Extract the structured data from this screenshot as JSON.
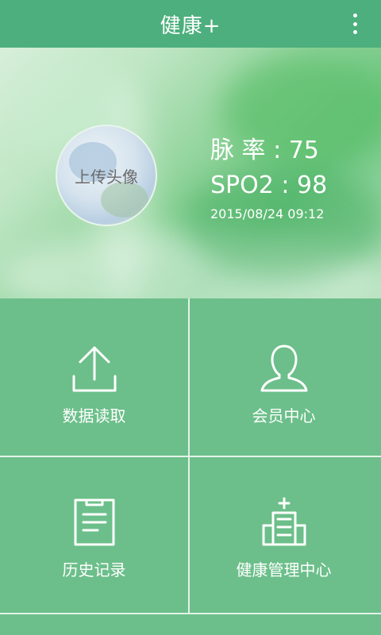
{
  "header": {
    "title": "健康+",
    "menu_icon": "more-vertical-icon"
  },
  "profile": {
    "avatar_label": "上传头像",
    "pulse_text": "脉 率 : 75",
    "spo2_text": "SPO2 : 98",
    "timestamp": "2015/08/24  09:12"
  },
  "tiles": [
    {
      "label": "数据读取",
      "icon": "upload-icon"
    },
    {
      "label": "会员中心",
      "icon": "user-icon"
    },
    {
      "label": "历史记录",
      "icon": "clipboard-icon"
    },
    {
      "label": "健康管理中心",
      "icon": "hospital-icon"
    }
  ],
  "colors": {
    "topbar": "#4caf7d",
    "grid": "#6cbf8a",
    "divider": "#e3f2e8",
    "text": "#ffffff"
  }
}
